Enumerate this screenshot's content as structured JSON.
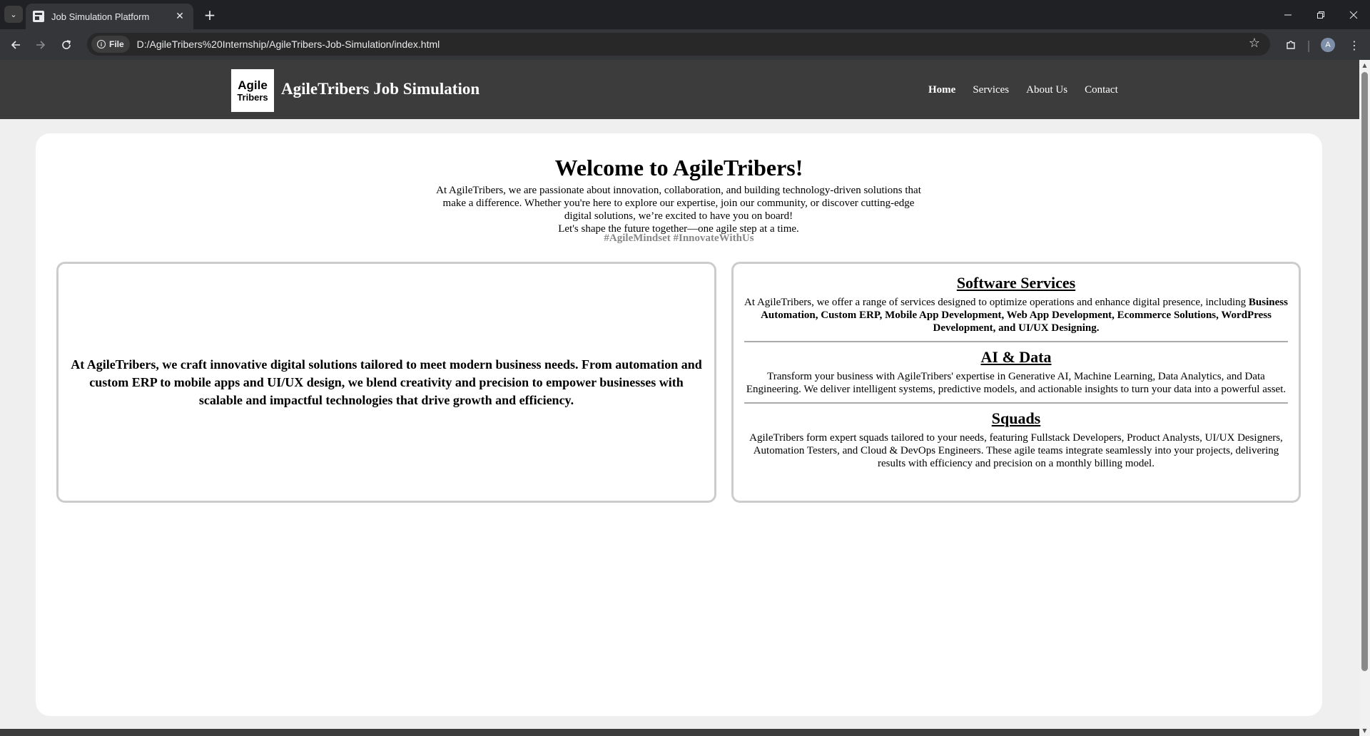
{
  "browser": {
    "tab_title": "Job Simulation Platform",
    "tab_close": "✕",
    "new_tab": "+",
    "chip_label": "File",
    "chip_icon": "i",
    "url": "D:/AgileTribers%20Internship/AgileTribers-Job-Simulation/index.html",
    "avatar_letter": "A",
    "icons": {
      "tab_list": "chevron-down-icon",
      "back": "back-arrow-icon",
      "forward": "forward-arrow-icon",
      "reload": "reload-icon",
      "star": "star-icon",
      "extensions": "puzzle-icon",
      "menu": "kebab-menu-icon",
      "minimize": "minimize-icon",
      "restore": "restore-icon",
      "close": "close-icon"
    }
  },
  "site": {
    "logo_line1": "Agile",
    "logo_line2": "Tribers",
    "brand": "AgileTribers Job Simulation",
    "nav": [
      {
        "label": "Home",
        "active": true
      },
      {
        "label": "Services",
        "active": false
      },
      {
        "label": "About Us",
        "active": false
      },
      {
        "label": "Contact",
        "active": false
      }
    ]
  },
  "hero": {
    "title": "Welcome to AgileTribers!",
    "line1": "At AgileTribers, we are passionate about innovation, collaboration, and building technology-driven solutions that make a difference. Whether you're here to explore our expertise, join our community, or discover cutting-edge digital solutions, we’re excited to have you on board!",
    "line2": "Let's shape the future together—one agile step at a time.",
    "hashtags": "#AgileMindset #InnovateWithUs"
  },
  "intro_box": {
    "text": "At AgileTribers, we craft innovative digital solutions tailored to meet modern business needs. From automation and custom ERP to mobile apps and UI/UX design, we blend creativity and precision to empower businesses with scalable and impactful technologies that drive growth and efficiency."
  },
  "services": {
    "software": {
      "title": "Software Services",
      "intro": "At AgileTribers, we offer a range of services designed to optimize operations and enhance digital presence, including ",
      "highlight": "Business Automation, Custom ERP, Mobile App Development, Web App Development, Ecommerce Solutions, WordPress Development, and UI/UX Designing."
    },
    "ai": {
      "title": "AI & Data",
      "text": "Transform your business with AgileTribers' expertise in Generative AI, Machine Learning, Data Analytics, and Data Engineering. We deliver intelligent systems, predictive models, and actionable insights to turn your data into a powerful asset."
    },
    "squads": {
      "title": "Squads",
      "text": "AgileTribers form expert squads tailored to your needs, featuring Fullstack Developers, Product Analysts, UI/UX Designers, Automation Testers, and Cloud & DevOps Engineers. These agile teams integrate seamlessly into your projects, delivering results with efficiency and precision on a monthly billing model."
    }
  }
}
